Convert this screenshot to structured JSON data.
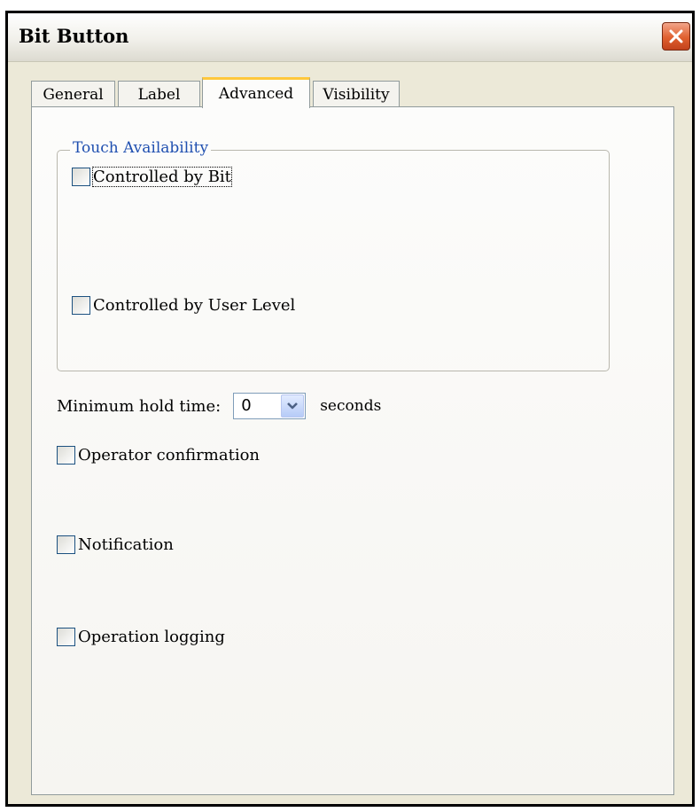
{
  "window": {
    "title": "Bit Button",
    "close_icon": "close-x-icon"
  },
  "tabs": [
    {
      "label": "General",
      "active": false
    },
    {
      "label": "Label",
      "active": false
    },
    {
      "label": "Advanced",
      "active": true
    },
    {
      "label": "Visibility",
      "active": false
    }
  ],
  "touch_availability": {
    "legend": "Touch Availability",
    "controlled_by_bit": {
      "label": "Controlled by Bit",
      "checked": false
    },
    "controlled_by_user_level": {
      "label": "Controlled by User Level",
      "checked": false
    }
  },
  "min_hold": {
    "label": "Minimum hold time:",
    "value": "0",
    "unit": "seconds"
  },
  "options": {
    "operator_confirmation": {
      "label": "Operator confirmation",
      "checked": false
    },
    "notification": {
      "label": "Notification",
      "checked": false
    },
    "operation_logging": {
      "label": "Operation logging",
      "checked": false
    }
  },
  "colors": {
    "close_button": "#e0602f",
    "active_tab_accent": "#ffc83c",
    "legend_text": "#1f4fb0",
    "checkbox_border": "#1c5180"
  }
}
